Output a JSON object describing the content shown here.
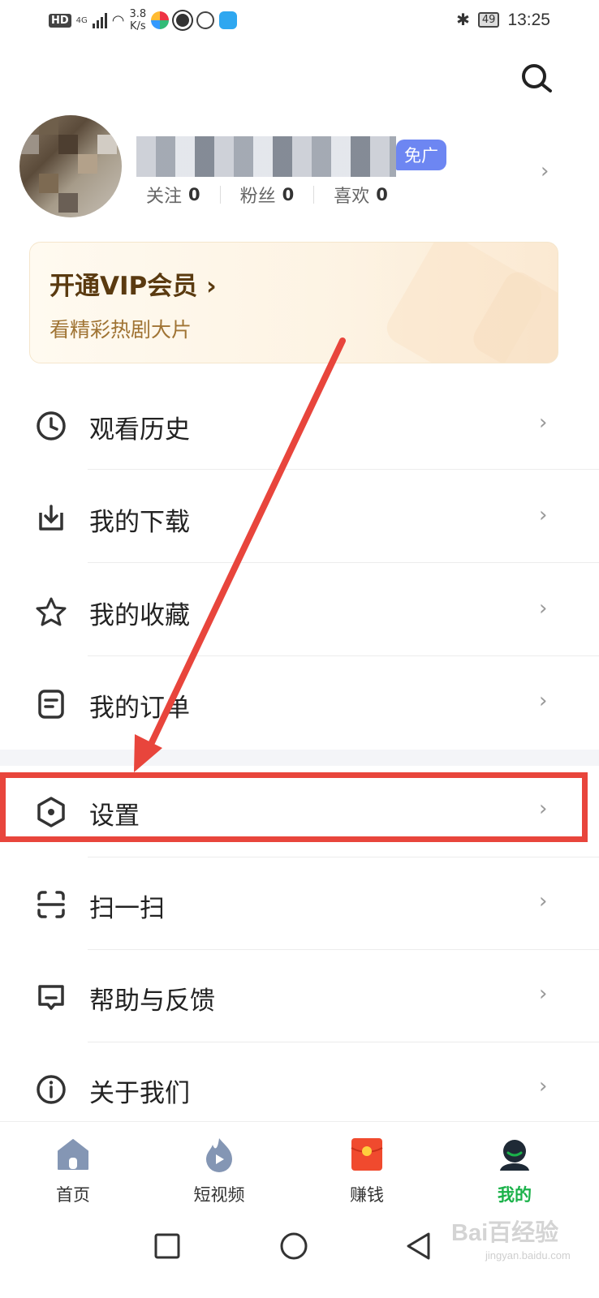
{
  "status_bar": {
    "hd": "HD",
    "signal": "4G",
    "speed_value": "3.8",
    "speed_unit": "K/s",
    "battery": "49",
    "time": "13:25"
  },
  "profile": {
    "vip_badge": "免广",
    "stats": [
      {
        "label": "关注",
        "value": "0"
      },
      {
        "label": "粉丝",
        "value": "0"
      },
      {
        "label": "喜欢",
        "value": "0"
      }
    ]
  },
  "vip_card": {
    "title": "开通VIP会员",
    "title_chevron": "›",
    "subtitle": "看精彩热剧大片"
  },
  "menu": {
    "items": [
      {
        "label": "观看历史",
        "icon": "clock-icon"
      },
      {
        "label": "我的下载",
        "icon": "download-icon"
      },
      {
        "label": "我的收藏",
        "icon": "star-icon"
      },
      {
        "label": "我的订单",
        "icon": "order-icon"
      },
      {
        "label": "设置",
        "icon": "settings-icon"
      },
      {
        "label": "扫一扫",
        "icon": "scan-icon"
      },
      {
        "label": "帮助与反馈",
        "icon": "feedback-icon"
      },
      {
        "label": "关于我们",
        "icon": "info-icon"
      }
    ],
    "chevron": "›"
  },
  "tabbar": {
    "tabs": [
      {
        "label": "首页",
        "icon": "home-icon"
      },
      {
        "label": "短视频",
        "icon": "flame-icon"
      },
      {
        "label": "赚钱",
        "icon": "red-packet-icon"
      },
      {
        "label": "我的",
        "icon": "profile-icon",
        "active": true
      }
    ]
  },
  "watermark": {
    "brand": "Bai百经验",
    "url": "jingyan.baidu.com"
  },
  "colors": {
    "accent_green": "#1bb24a",
    "annotation_red": "#e8453c",
    "vip_badge_blue": "#6d86f2",
    "vip_title_brown": "#5a3a10",
    "vip_sub_gold": "#a07434"
  }
}
